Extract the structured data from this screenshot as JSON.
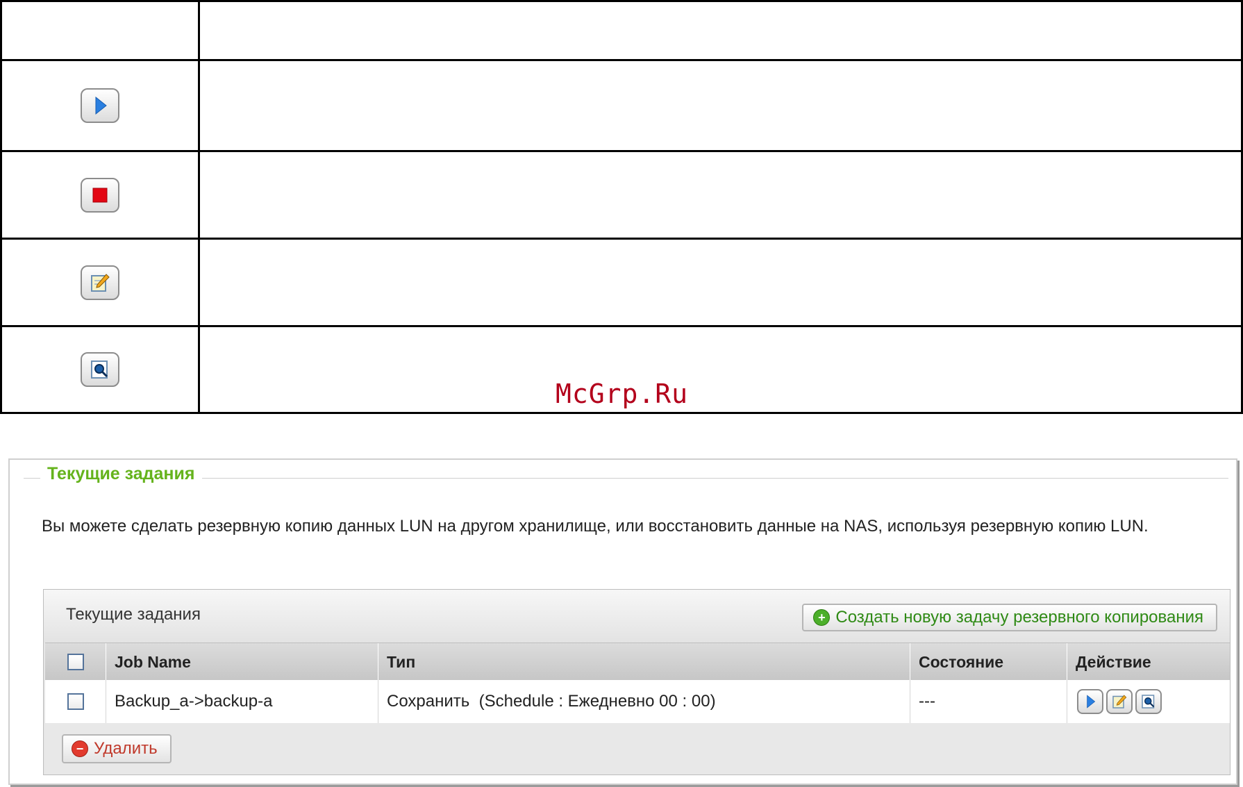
{
  "watermark": "McGrp.Ru",
  "legend_icons": [
    "play-icon",
    "stop-icon",
    "edit-icon",
    "view-log-icon"
  ],
  "section": {
    "title": "Текущие задания",
    "description": "Вы можете сделать резервную копию данных LUN на другом хранилище, или восстановить данные на NAS, используя резервную копию LUN."
  },
  "grid": {
    "title": "Текущие задания",
    "create_button_label": "Создать новую задачу резервного копирования",
    "columns": [
      "Job Name",
      "Тип",
      "Состояние",
      "Действие"
    ],
    "rows": [
      {
        "job_name": "Backup_a->backup-a",
        "type": "Сохранить  (Schedule : Ежедневно 00 : 00)",
        "status": "---",
        "actions": [
          "play-icon",
          "edit-icon",
          "view-log-icon"
        ]
      }
    ],
    "delete_button_label": "Удалить"
  },
  "colors": {
    "section_title": "#65b31c",
    "create_text": "#2f8a15",
    "delete_text": "#c0392b",
    "watermark": "#b3001b"
  }
}
